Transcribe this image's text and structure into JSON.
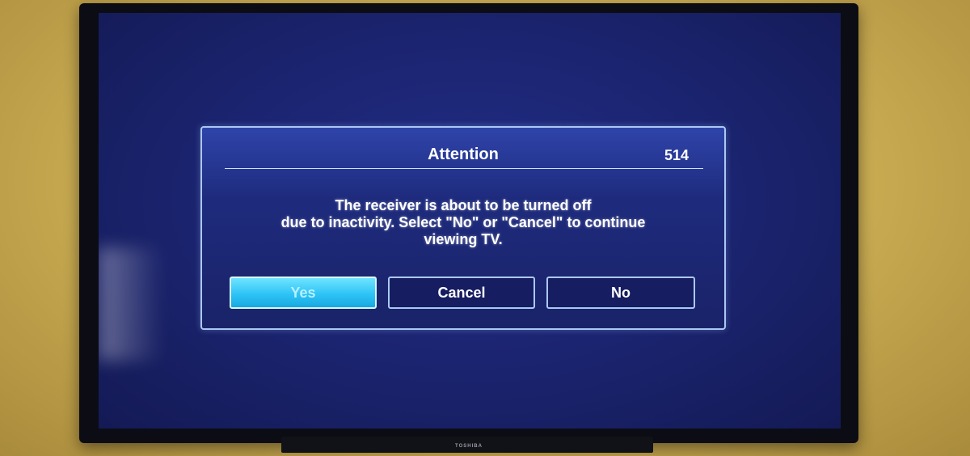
{
  "tv": {
    "brand": "TOSHIBA"
  },
  "dialog": {
    "title": "Attention",
    "code": "514",
    "message_lines": [
      "The receiver is about to be turned off",
      "due to inactivity. Select \"No\" or \"Cancel\" to continue",
      "viewing TV."
    ],
    "buttons": {
      "yes": "Yes",
      "cancel": "Cancel",
      "no": "No"
    },
    "selected_button": "yes"
  },
  "colors": {
    "screen": "#1b2470",
    "dialog_border": "#aac8f4",
    "selected_button": "#2ec4f6",
    "wall": "#c9ab52"
  }
}
